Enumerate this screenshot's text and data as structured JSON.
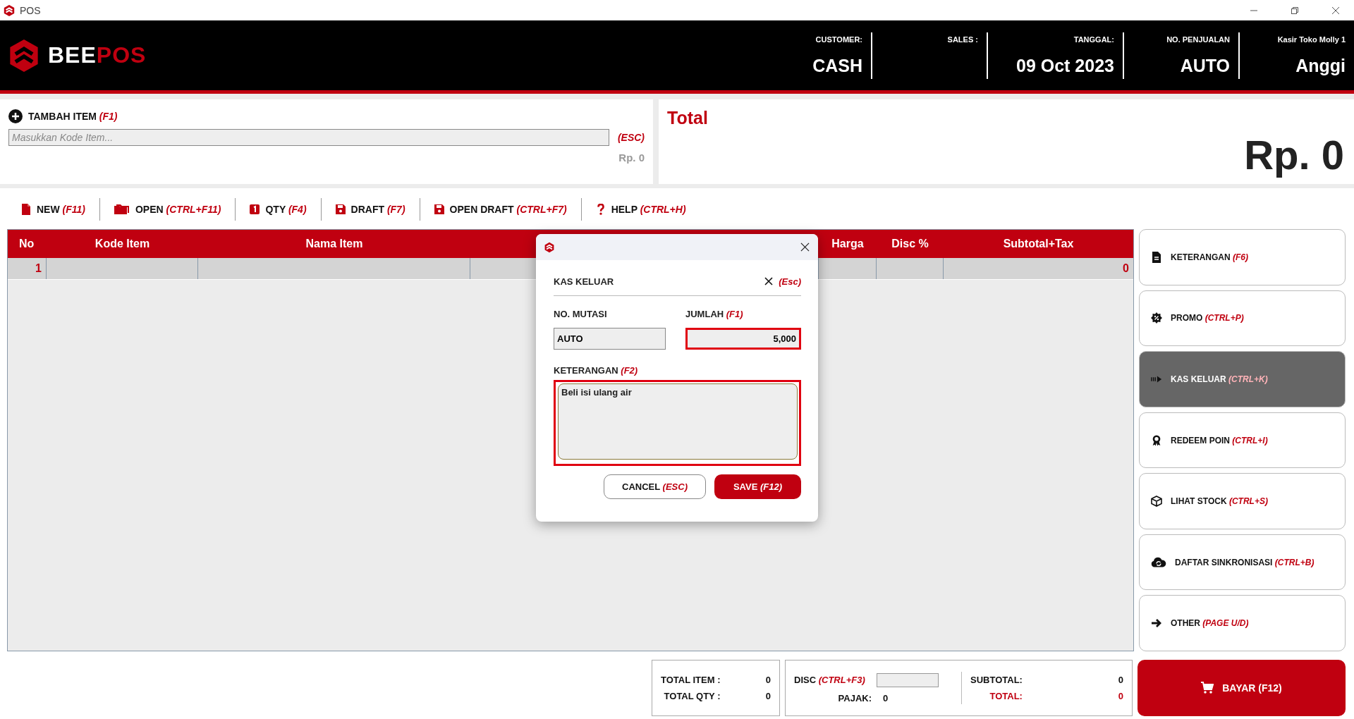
{
  "window": {
    "title": "POS"
  },
  "header": {
    "brand": {
      "part_1": "BEE",
      "part_2": "POS"
    },
    "fields": [
      {
        "label": "CUSTOMER:",
        "value": "CASH"
      },
      {
        "label": "SALES :"
      },
      {
        "label": "TANGGAL:",
        "value": "09 Oct 2023"
      },
      {
        "label": "NO. PENJUALAN",
        "value": "AUTO"
      },
      {
        "label": "Kasir Toko Molly 1",
        "value": "Anggi"
      }
    ]
  },
  "add_item": {
    "label": "TAMBAH ITEM",
    "shortcut": "(F1)",
    "input": {
      "placeholder": "Masukkan Kode Item..."
    },
    "esc": "(ESC)",
    "amount": "Rp. 0"
  },
  "total": {
    "label": "Total",
    "value": "Rp. 0"
  },
  "toolbar": [
    {
      "label": "NEW",
      "shortcut": "(F11)"
    },
    {
      "label": "OPEN",
      "shortcut": "(CTRL+F11)"
    },
    {
      "label": "QTY",
      "shortcut": "(F4)"
    },
    {
      "label": "DRAFT",
      "shortcut": "(F7)"
    },
    {
      "label": "OPEN DRAFT",
      "shortcut": "(CTRL+F7)"
    },
    {
      "label": "HELP",
      "shortcut": "(CTRL+H)"
    }
  ],
  "table": {
    "columns": [
      "No",
      "Kode Item",
      "Nama Item",
      "Harga",
      "Disc %",
      "Subtotal+Tax"
    ],
    "rows": [
      {
        "no": "1",
        "subtotal": "0"
      }
    ]
  },
  "side_buttons": [
    {
      "label": "KETERANGAN",
      "shortcut": "(F6)",
      "selected": false
    },
    {
      "label": "PROMO",
      "shortcut": "(CTRL+P)",
      "selected": false
    },
    {
      "label": "KAS KELUAR",
      "shortcut": "(CTRL+K)",
      "selected": true
    },
    {
      "label": "REDEEM POIN",
      "shortcut": "(CTRL+I)",
      "selected": false
    },
    {
      "label": "LIHAT STOCK",
      "shortcut": "(CTRL+S)",
      "selected": false
    },
    {
      "label": "DAFTAR SINKRONISASI",
      "shortcut": "(CTRL+B)",
      "selected": false
    },
    {
      "label": "OTHER",
      "shortcut": "(PAGE U/D)",
      "selected": false
    }
  ],
  "pay_button": {
    "label": "BAYAR (F12)"
  },
  "summary": {
    "total_item": {
      "label": "TOTAL ITEM :",
      "value": "0"
    },
    "total_qty": {
      "label": "TOTAL QTY :",
      "value": "0"
    },
    "disc": {
      "label": "DISC",
      "shortcut": "(CTRL+F3)"
    },
    "pajak": {
      "label": "PAJAK:",
      "value": "0"
    },
    "subtotal": {
      "label": "SUBTOTAL:",
      "value": "0"
    },
    "total": {
      "label": "TOTAL:",
      "value": "0"
    }
  },
  "dialog": {
    "title": "KAS KELUAR",
    "close_shortcut": "(Esc)",
    "mutasi": {
      "label": "NO. MUTASI",
      "value": "AUTO"
    },
    "jumlah": {
      "label": "JUMLAH",
      "shortcut": "(F1)",
      "value": "5,000"
    },
    "keterangan": {
      "label": "KETERANGAN",
      "shortcut": "(F2)",
      "value": "Beli isi ulang air"
    },
    "cancel": {
      "label": "CANCEL",
      "shortcut": "(ESC)"
    },
    "save": {
      "label": "SAVE",
      "shortcut": "(F12)"
    }
  }
}
